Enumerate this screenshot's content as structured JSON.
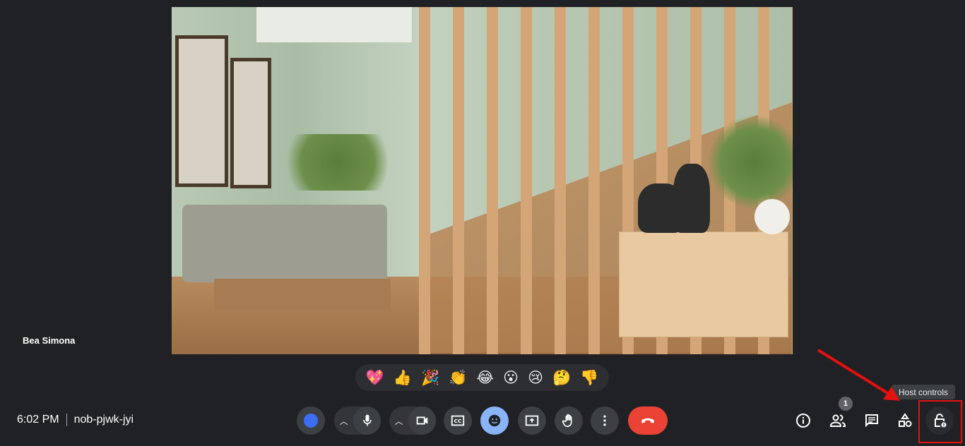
{
  "participant": {
    "name": "Bea Simona"
  },
  "meeting": {
    "time": "6:02 PM",
    "code": "nob-pjwk-jyi"
  },
  "reactions": [
    "💖",
    "👍",
    "🎉",
    "👏",
    "😂",
    "😮",
    "😢",
    "🤔",
    "👎"
  ],
  "controls": {
    "people_count": "1",
    "tooltip": "Host controls"
  },
  "colors": {
    "background": "#202124",
    "active_reaction": "#8ab4f8",
    "end_call": "#ea4335",
    "annotation": "#e3110f",
    "avatar_dot": "#3d6df2"
  }
}
